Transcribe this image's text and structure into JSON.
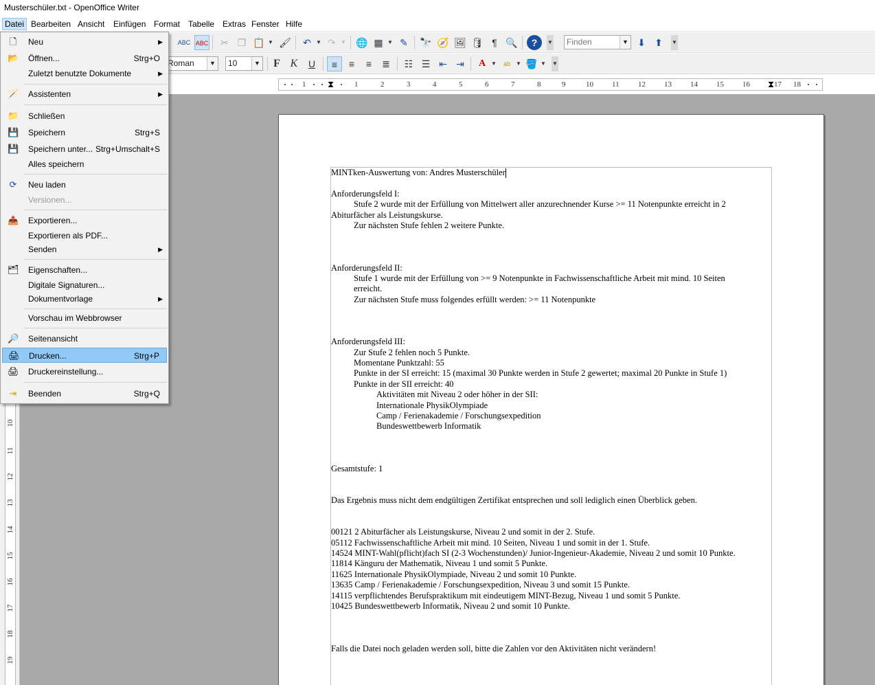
{
  "window": {
    "title": "Musterschüler.txt - OpenOffice Writer"
  },
  "menubar": {
    "items": [
      "Datei",
      "Bearbeiten",
      "Ansicht",
      "Einfügen",
      "Format",
      "Tabelle",
      "Extras",
      "Fenster",
      "Hilfe"
    ],
    "active": "Datei"
  },
  "toolbar": {
    "find_placeholder": "Finden",
    "font_name": "Roman",
    "font_size": "10"
  },
  "ruler": {
    "labels": [
      "1",
      "1",
      "2",
      "3",
      "4",
      "5",
      "6",
      "7",
      "8",
      "9",
      "10",
      "11",
      "12",
      "13",
      "14",
      "15",
      "16",
      "17",
      "18"
    ],
    "vertical_labels": [
      "10",
      "11",
      "12",
      "13",
      "14",
      "15",
      "16",
      "17",
      "18",
      "19"
    ]
  },
  "file_menu": {
    "items": [
      {
        "label": "Neu",
        "accel": "",
        "icon": "new-doc-icon",
        "submenu": true
      },
      {
        "label": "Öffnen...",
        "accel": "Strg+O",
        "icon": "open-folder-icon"
      },
      {
        "label": "Zuletzt benutzte Dokumente",
        "accel": "",
        "icon": "",
        "submenu": true
      },
      {
        "label": "Assistenten",
        "accel": "",
        "icon": "wizard-icon",
        "submenu": true
      },
      {
        "label": "Schließen",
        "accel": "",
        "icon": "close-doc-icon"
      },
      {
        "label": "Speichern",
        "accel": "Strg+S",
        "icon": "save-icon"
      },
      {
        "label": "Speichern unter...",
        "accel": "Strg+Umschalt+S",
        "icon": "save-as-icon"
      },
      {
        "label": "Alles speichern",
        "accel": "",
        "icon": ""
      },
      {
        "label": "Neu laden",
        "accel": "",
        "icon": "reload-icon"
      },
      {
        "label": "Versionen...",
        "accel": "",
        "icon": "",
        "disabled": true
      },
      {
        "label": "Exportieren...",
        "accel": "",
        "icon": "export-icon"
      },
      {
        "label": "Exportieren als PDF...",
        "accel": "",
        "icon": ""
      },
      {
        "label": "Senden",
        "accel": "",
        "icon": "",
        "submenu": true
      },
      {
        "label": "Eigenschaften...",
        "accel": "",
        "icon": "properties-icon"
      },
      {
        "label": "Digitale Signaturen...",
        "accel": "",
        "icon": ""
      },
      {
        "label": "Dokumentvorlage",
        "accel": "",
        "icon": "",
        "submenu": true
      },
      {
        "label": "Vorschau im Webbrowser",
        "accel": "",
        "icon": ""
      },
      {
        "label": "Seitenansicht",
        "accel": "",
        "icon": "page-preview-icon"
      },
      {
        "label": "Drucken...",
        "accel": "Strg+P",
        "icon": "print-icon",
        "selected": true
      },
      {
        "label": "Druckereinstellung...",
        "accel": "",
        "icon": "printer-settings-icon"
      },
      {
        "label": "Beenden",
        "accel": "Strg+Q",
        "icon": "exit-icon"
      }
    ]
  },
  "document": {
    "lines": [
      {
        "text": "MINTken-Auswertung von: Andres Musterschüler",
        "indent": 0
      },
      {
        "text": "",
        "indent": 0
      },
      {
        "text": "Anforderungsfeld I:",
        "indent": 0
      },
      {
        "text": "Stufe 2 wurde mit der Erfüllung von Mittelwert aller anzurechnender Kurse >= 11 Notenpunkte erreicht in 2",
        "indent": 1
      },
      {
        "text": "Abiturfächer als Leistungskurse.",
        "indent": 0
      },
      {
        "text": "Zur nächsten Stufe fehlen 2 weitere Punkte.",
        "indent": 1
      },
      {
        "text": "",
        "indent": 0
      },
      {
        "text": "",
        "indent": 0
      },
      {
        "text": "",
        "indent": 0
      },
      {
        "text": "Anforderungsfeld II:",
        "indent": 0
      },
      {
        "text": "Stufe 1 wurde mit der Erfüllung von >= 9 Notenpunkte in Fachwissenschaftliche Arbeit mit mind. 10 Seiten",
        "indent": 1
      },
      {
        "text": "erreicht.",
        "indent": 1
      },
      {
        "text": "Zur nächsten Stufe muss folgendes erfüllt werden: >= 11 Notenpunkte",
        "indent": 1
      },
      {
        "text": "",
        "indent": 0
      },
      {
        "text": "",
        "indent": 0
      },
      {
        "text": "",
        "indent": 0
      },
      {
        "text": "Anforderungsfeld III:",
        "indent": 0
      },
      {
        "text": "Zur Stufe 2 fehlen noch 5 Punkte.",
        "indent": 1
      },
      {
        "text": "Momentane Punktzahl: 55",
        "indent": 1
      },
      {
        "text": "Punkte in der SI erreicht: 15 (maximal 30 Punkte werden in Stufe 2 gewertet; maximal 20 Punkte in Stufe 1)",
        "indent": 1
      },
      {
        "text": "Punkte in der SII erreicht: 40",
        "indent": 1
      },
      {
        "text": "Aktivitäten mit Niveau 2 oder höher in der SII:",
        "indent": 2
      },
      {
        "text": "Internationale PhysikOlympiade",
        "indent": 2
      },
      {
        "text": "Camp / Ferienakademie / Forschungsexpedition",
        "indent": 2
      },
      {
        "text": "Bundeswettbewerb Informatik",
        "indent": 2
      },
      {
        "text": "",
        "indent": 0
      },
      {
        "text": "",
        "indent": 0
      },
      {
        "text": "",
        "indent": 0
      },
      {
        "text": "Gesamtstufe: 1",
        "indent": 0
      },
      {
        "text": "",
        "indent": 0
      },
      {
        "text": "",
        "indent": 0
      },
      {
        "text": "Das Ergebnis muss nicht dem endgültigen Zertifikat entsprechen und soll lediglich einen Überblick geben.",
        "indent": 0
      },
      {
        "text": "",
        "indent": 0
      },
      {
        "text": "",
        "indent": 0
      },
      {
        "text": "00121 2 Abiturfächer als Leistungskurse, Niveau 2 und somit in der 2. Stufe.",
        "indent": 0
      },
      {
        "text": "05112 Fachwissenschaftliche Arbeit mit mind. 10 Seiten, Niveau 1 und somit in der 1. Stufe.",
        "indent": 0
      },
      {
        "text": "14524 MINT-Wahl(pflicht)fach SI (2-3 Wochenstunden)/ Junior-Ingenieur-Akademie, Niveau 2 und somit 10 Punkte.",
        "indent": 0
      },
      {
        "text": "11814 Känguru der Mathematik, Niveau 1 und somit 5 Punkte.",
        "indent": 0
      },
      {
        "text": "11625 Internationale PhysikOlympiade, Niveau 2 und somit 10 Punkte.",
        "indent": 0
      },
      {
        "text": "13635 Camp / Ferienakademie / Forschungsexpedition, Niveau 3 und somit 15 Punkte.",
        "indent": 0
      },
      {
        "text": "14115 verpflichtendes Berufspraktikum mit eindeutigem MINT-Bezug, Niveau 1 und somit 5 Punkte.",
        "indent": 0
      },
      {
        "text": "10425 Bundeswettbewerb Informatik, Niveau 2 und somit 10 Punkte.",
        "indent": 0
      },
      {
        "text": "",
        "indent": 0
      },
      {
        "text": "",
        "indent": 0
      },
      {
        "text": "",
        "indent": 0
      },
      {
        "text": "Falls die Datei noch geladen werden soll, bitte die Zahlen vor den Aktivitäten nicht verändern!",
        "indent": 0
      }
    ]
  }
}
